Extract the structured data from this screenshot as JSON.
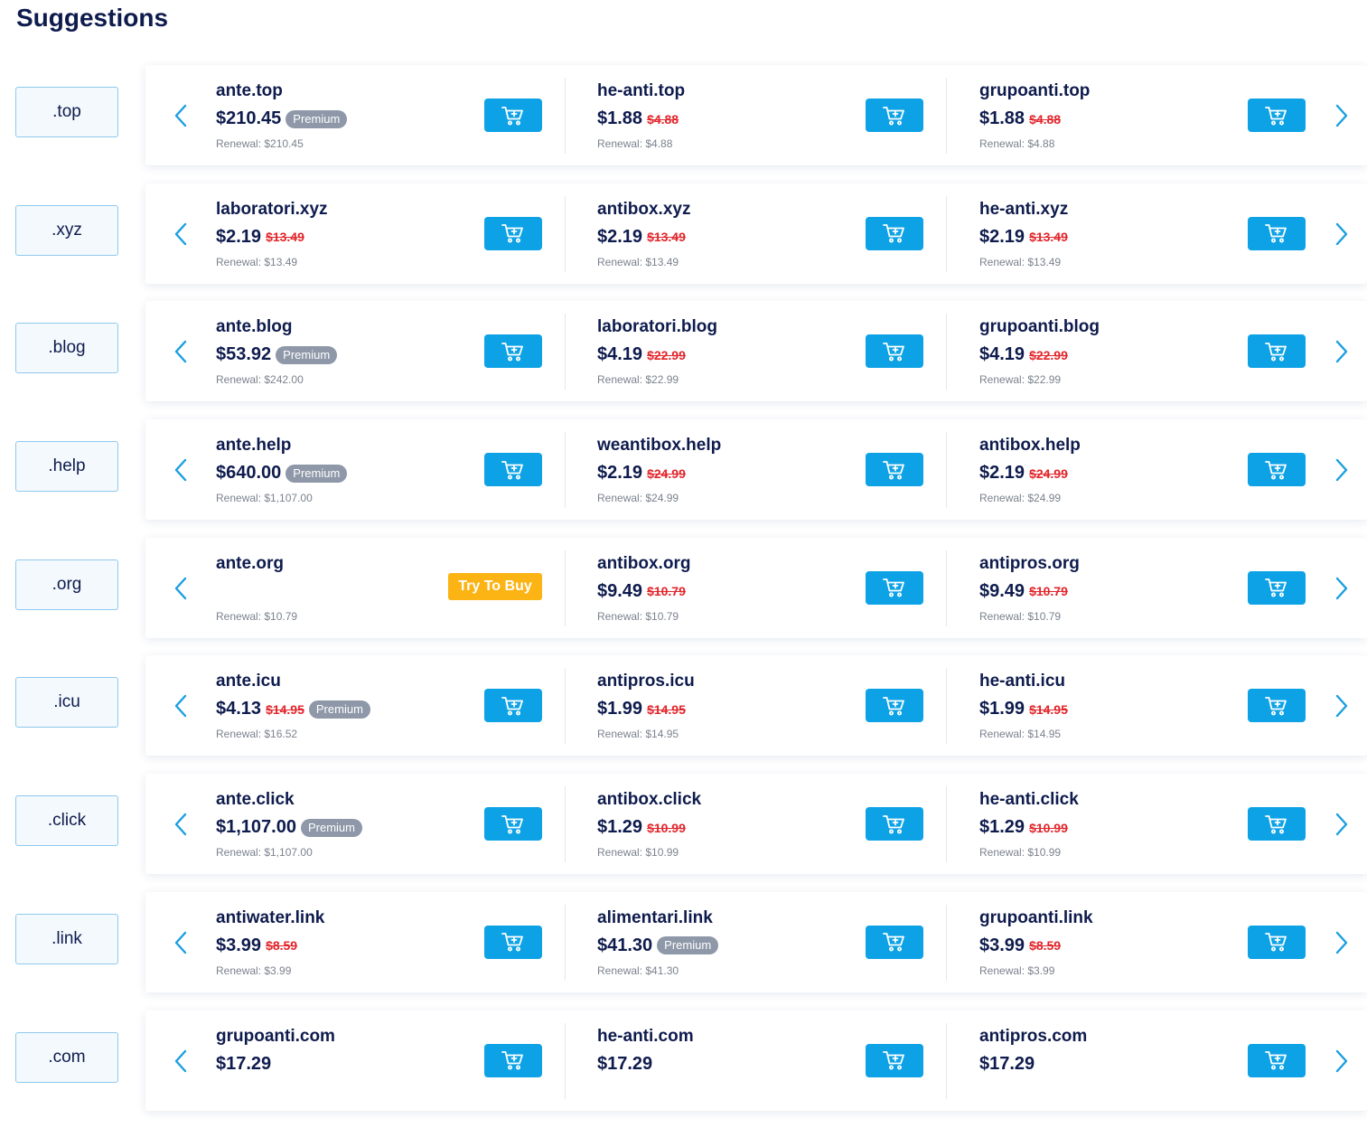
{
  "page_title": "Suggestions",
  "colors": {
    "accent": "#0da2e6",
    "title": "#0e1b4d",
    "strike": "#e2252b",
    "premium": "#8e98a8",
    "try_button": "#fcb314"
  },
  "rows": [
    {
      "tld": ".top",
      "items": [
        {
          "domain": "ante.top",
          "price": "$210.45",
          "old_price": "",
          "badge": "Premium",
          "renewal": "Renewal: $210.45",
          "action": "cart"
        },
        {
          "domain": "he-anti.top",
          "price": "$1.88",
          "old_price": "$4.88",
          "badge": "",
          "renewal": "Renewal: $4.88",
          "action": "cart"
        },
        {
          "domain": "grupoanti.top",
          "price": "$1.88",
          "old_price": "$4.88",
          "badge": "",
          "renewal": "Renewal: $4.88",
          "action": "cart"
        }
      ]
    },
    {
      "tld": ".xyz",
      "items": [
        {
          "domain": "laboratori.xyz",
          "price": "$2.19",
          "old_price": "$13.49",
          "badge": "",
          "renewal": "Renewal: $13.49",
          "action": "cart"
        },
        {
          "domain": "antibox.xyz",
          "price": "$2.19",
          "old_price": "$13.49",
          "badge": "",
          "renewal": "Renewal: $13.49",
          "action": "cart"
        },
        {
          "domain": "he-anti.xyz",
          "price": "$2.19",
          "old_price": "$13.49",
          "badge": "",
          "renewal": "Renewal: $13.49",
          "action": "cart"
        }
      ]
    },
    {
      "tld": ".blog",
      "items": [
        {
          "domain": "ante.blog",
          "price": "$53.92",
          "old_price": "",
          "badge": "Premium",
          "renewal": "Renewal: $242.00",
          "action": "cart"
        },
        {
          "domain": "laboratori.blog",
          "price": "$4.19",
          "old_price": "$22.99",
          "badge": "",
          "renewal": "Renewal: $22.99",
          "action": "cart"
        },
        {
          "domain": "grupoanti.blog",
          "price": "$4.19",
          "old_price": "$22.99",
          "badge": "",
          "renewal": "Renewal: $22.99",
          "action": "cart"
        }
      ]
    },
    {
      "tld": ".help",
      "items": [
        {
          "domain": "ante.help",
          "price": "$640.00",
          "old_price": "",
          "badge": "Premium",
          "renewal": "Renewal: $1,107.00",
          "action": "cart"
        },
        {
          "domain": "weantibox.help",
          "price": "$2.19",
          "old_price": "$24.99",
          "badge": "",
          "renewal": "Renewal: $24.99",
          "action": "cart"
        },
        {
          "domain": "antibox.help",
          "price": "$2.19",
          "old_price": "$24.99",
          "badge": "",
          "renewal": "Renewal: $24.99",
          "action": "cart"
        }
      ]
    },
    {
      "tld": ".org",
      "items": [
        {
          "domain": "ante.org",
          "price": "",
          "old_price": "",
          "badge": "",
          "renewal": "Renewal: $10.79",
          "action": "try",
          "try_label": "Try To Buy"
        },
        {
          "domain": "antibox.org",
          "price": "$9.49",
          "old_price": "$10.79",
          "badge": "",
          "renewal": "Renewal: $10.79",
          "action": "cart"
        },
        {
          "domain": "antipros.org",
          "price": "$9.49",
          "old_price": "$10.79",
          "badge": "",
          "renewal": "Renewal: $10.79",
          "action": "cart"
        }
      ]
    },
    {
      "tld": ".icu",
      "items": [
        {
          "domain": "ante.icu",
          "price": "$4.13",
          "old_price": "$14.95",
          "badge": "Premium",
          "renewal": "Renewal: $16.52",
          "action": "cart"
        },
        {
          "domain": "antipros.icu",
          "price": "$1.99",
          "old_price": "$14.95",
          "badge": "",
          "renewal": "Renewal: $14.95",
          "action": "cart"
        },
        {
          "domain": "he-anti.icu",
          "price": "$1.99",
          "old_price": "$14.95",
          "badge": "",
          "renewal": "Renewal: $14.95",
          "action": "cart"
        }
      ]
    },
    {
      "tld": ".click",
      "items": [
        {
          "domain": "ante.click",
          "price": "$1,107.00",
          "old_price": "",
          "badge": "Premium",
          "renewal": "Renewal: $1,107.00",
          "action": "cart"
        },
        {
          "domain": "antibox.click",
          "price": "$1.29",
          "old_price": "$10.99",
          "badge": "",
          "renewal": "Renewal: $10.99",
          "action": "cart"
        },
        {
          "domain": "he-anti.click",
          "price": "$1.29",
          "old_price": "$10.99",
          "badge": "",
          "renewal": "Renewal: $10.99",
          "action": "cart"
        }
      ]
    },
    {
      "tld": ".link",
      "items": [
        {
          "domain": "antiwater.link",
          "price": "$3.99",
          "old_price": "$8.59",
          "badge": "",
          "renewal": "Renewal: $3.99",
          "action": "cart"
        },
        {
          "domain": "alimentari.link",
          "price": "$41.30",
          "old_price": "",
          "badge": "Premium",
          "renewal": "Renewal: $41.30",
          "action": "cart"
        },
        {
          "domain": "grupoanti.link",
          "price": "$3.99",
          "old_price": "$8.59",
          "badge": "",
          "renewal": "Renewal: $3.99",
          "action": "cart"
        }
      ]
    },
    {
      "tld": ".com",
      "items": [
        {
          "domain": "grupoanti.com",
          "price": "$17.29",
          "old_price": "",
          "badge": "",
          "renewal": "",
          "action": "cart"
        },
        {
          "domain": "he-anti.com",
          "price": "$17.29",
          "old_price": "",
          "badge": "",
          "renewal": "",
          "action": "cart"
        },
        {
          "domain": "antipros.com",
          "price": "$17.29",
          "old_price": "",
          "badge": "",
          "renewal": "",
          "action": "cart"
        }
      ]
    }
  ]
}
